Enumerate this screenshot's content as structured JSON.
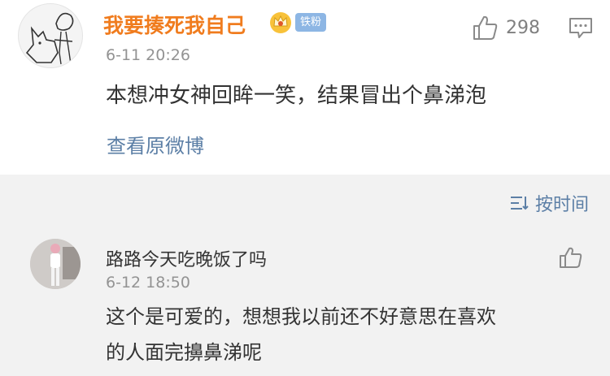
{
  "post": {
    "username": "我要揍死我自己",
    "badge": "铁粉",
    "like_count": "298",
    "time": "6-11 20:26",
    "text": "本想冲女神回眸一笑，结果冒出个鼻涕泡",
    "view_original": "查看原微博"
  },
  "sort": {
    "label": "按时间"
  },
  "reply": {
    "username": "路路今天吃晚饭了吗",
    "time": "6-12 18:50",
    "text_line1": "这个是可爱的，想想我以前还不好意思在喜欢",
    "text_line2": "的人面完擤鼻涕呢"
  },
  "colors": {
    "username": "#f07c1e",
    "link": "#5c7fa6",
    "badge": "#8db6e4"
  }
}
